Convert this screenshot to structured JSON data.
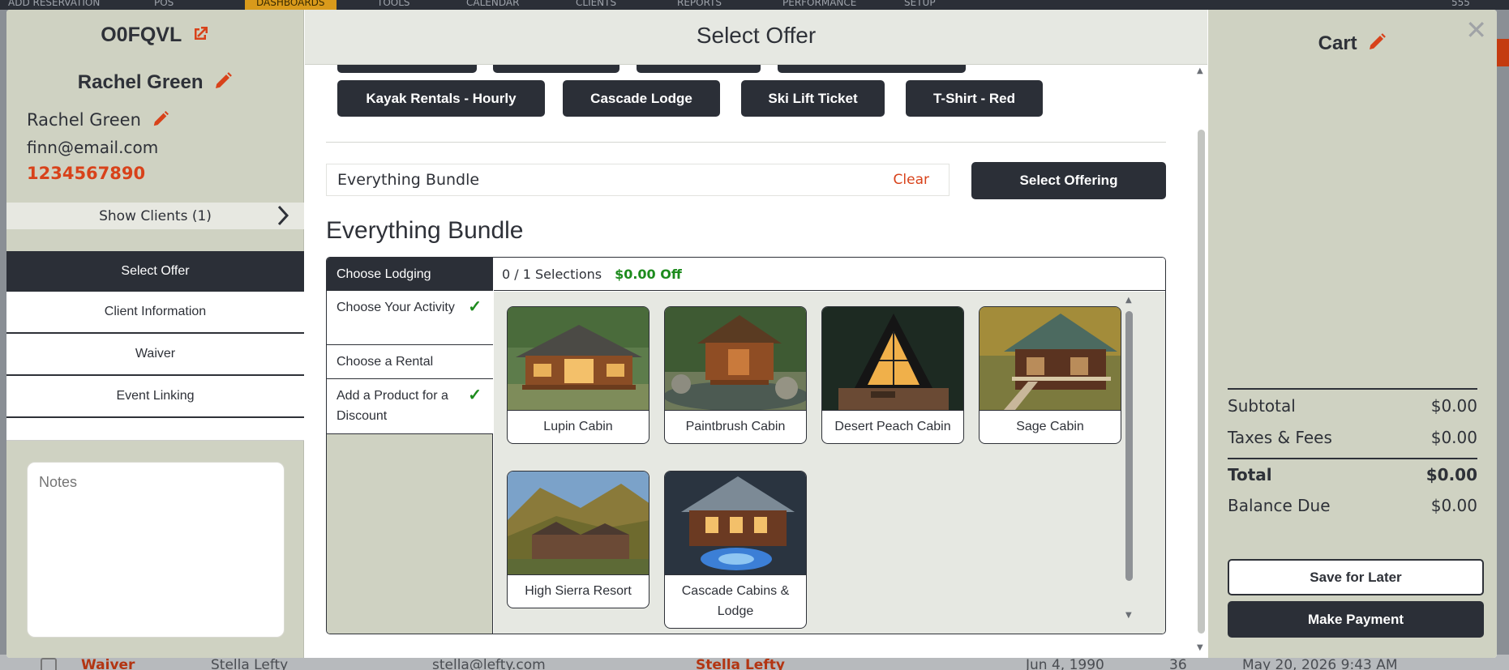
{
  "background": {
    "nav": [
      "ADD RESERVATION",
      "POS",
      "DASHBOARDS",
      "TOOLS",
      "CALENDAR",
      "CLIENTS",
      "REPORTS",
      "PERFORMANCE",
      "SETUP",
      "555"
    ],
    "row": {
      "type": "Waiver",
      "name": "Stella Lefty",
      "email": "stella@lefty.com",
      "linked": "Stella Lefty",
      "dob": "Jun 4, 1990",
      "age": "36",
      "date": "May 20, 2026 9:43 AM"
    }
  },
  "left": {
    "reservation_code": "O0FQVL",
    "client_display_name": "Rachel Green",
    "client_name": "Rachel Green",
    "email": "finn@email.com",
    "phone": "1234567890",
    "show_clients": "Show Clients (1)",
    "menu": [
      "Select Offer",
      "Client Information",
      "Waiver",
      "Event Linking"
    ],
    "notes_placeholder": "Notes"
  },
  "center": {
    "title": "Select Offer",
    "offer_chips": [
      "Kayak Rentals - Hourly",
      "Cascade Lodge",
      "Ski Lift Ticket",
      "T-Shirt - Red"
    ],
    "search_value": "Everything Bundle",
    "clear_label": "Clear",
    "select_button": "Select Offering",
    "bundle_title": "Everything Bundle",
    "steps": [
      {
        "label": "Choose Lodging",
        "done": false
      },
      {
        "label": "Choose Your Activity",
        "done": true
      },
      {
        "label": "Choose a Rental",
        "done": false
      },
      {
        "label": "Add a Product for a Discount",
        "done": true
      }
    ],
    "selections": "0 / 1 Selections",
    "discount": "$0.00 Off",
    "lodging_options": [
      "Lupin Cabin",
      "Paintbrush Cabin",
      "Desert Peach Cabin",
      "Sage Cabin",
      "High Sierra Resort",
      "Cascade Cabins & Lodge"
    ]
  },
  "cart": {
    "title": "Cart",
    "subtotal_label": "Subtotal",
    "subtotal": "$0.00",
    "taxes_label": "Taxes & Fees",
    "taxes": "$0.00",
    "total_label": "Total",
    "total": "$0.00",
    "balance_label": "Balance Due",
    "balance": "$0.00",
    "save_later": "Save for Later",
    "make_payment": "Make Payment"
  },
  "colors": {
    "accent": "#d8421a",
    "dark": "#2b2f37",
    "panel": "#cfd2c2",
    "success": "#1d8b1d"
  },
  "icons": {
    "external_link": "external-link-icon",
    "edit": "pencil-icon",
    "chevron": "chevron-right-icon",
    "check": "check-icon",
    "close": "close-icon"
  }
}
